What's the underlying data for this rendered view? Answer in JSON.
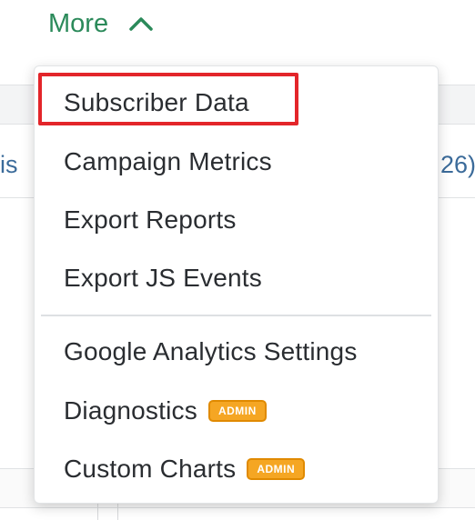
{
  "more_toggle": {
    "label": "More",
    "icon": "chevron-up-icon"
  },
  "background": {
    "left_text_fragment": "is",
    "right_text_fragment": "26)"
  },
  "menu": {
    "items": [
      {
        "label": "Subscriber Data"
      },
      {
        "label": "Campaign Metrics"
      },
      {
        "label": "Export Reports"
      },
      {
        "label": "Export JS Events"
      },
      {
        "label": "Google Analytics Settings"
      },
      {
        "label": "Diagnostics",
        "badge": "ADMIN"
      },
      {
        "label": "Custom Charts",
        "badge": "ADMIN"
      }
    ],
    "highlighted_item": "Subscriber Data"
  },
  "colors": {
    "accent": "#2b8a5a",
    "highlight_border": "#e3252a",
    "badge_bg": "#f5a623",
    "badge_border": "#e08a00",
    "menu_text": "#2a2d31"
  }
}
